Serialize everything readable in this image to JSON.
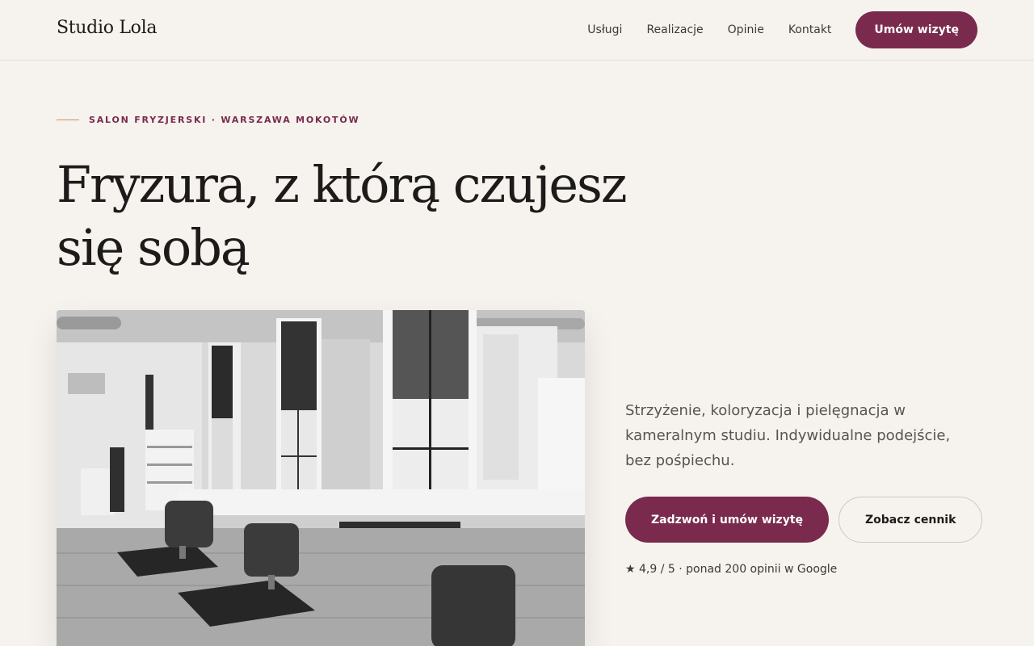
{
  "header": {
    "logo": "Studio Lola",
    "nav": [
      "Usługi",
      "Realizacje",
      "Opinie",
      "Kontakt"
    ],
    "cta": "Umów wizytę"
  },
  "hero": {
    "eyebrow": "SALON FRYZJERSKI · WARSZAWA MOKOTÓW",
    "headline": "Fryzura, z którą czujesz się sobą",
    "lead": "Strzyżenie, koloryzacja i pielęgnacja w kameralnym studiu. Indywidualne podejście, bez pośpiechu.",
    "primary_button": "Zadzwoń i umów wizytę",
    "secondary_button": "Zobacz cennik",
    "rating": "★ 4,9 / 5 · ponad 200 opinii w Google"
  },
  "colors": {
    "background": "#f6f3ee",
    "accent": "#7a2a4d",
    "eyebrow_line": "#c9925f"
  }
}
